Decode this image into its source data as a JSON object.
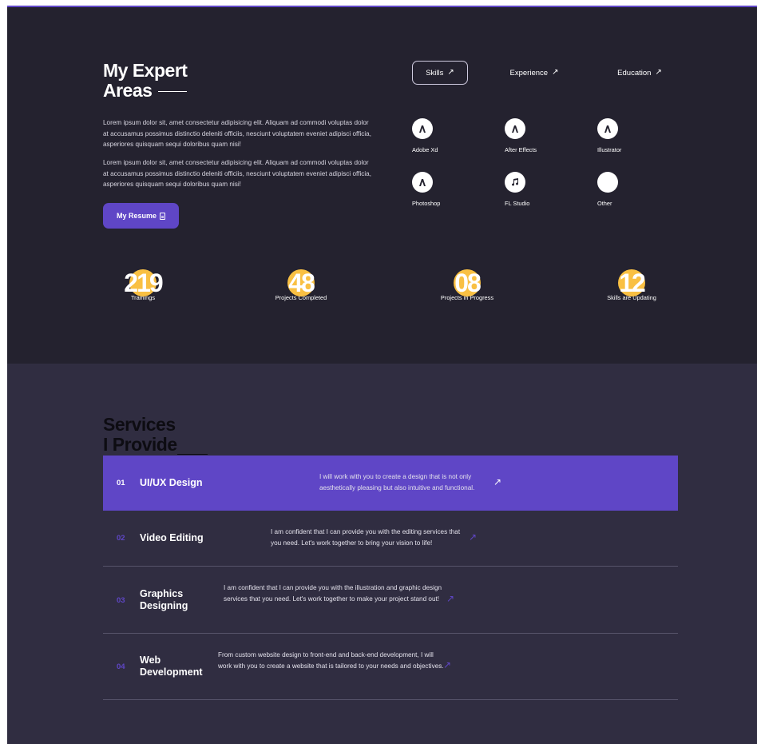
{
  "expert": {
    "title_line1": "My Expert",
    "title_line2": "Areas",
    "para1": "Lorem ipsum dolor sit, amet consectetur adipisicing elit. Aliquam ad commodi voluptas dolor at accusamus possimus distinctio deleniti officiis, nesciunt voluptatem eveniet adipisci officia, asperiores quisquam sequi doloribus quam nisi!",
    "para2": "Lorem ipsum dolor sit, amet consectetur adipisicing elit. Aliquam ad commodi voluptas dolor at accusamus possimus distinctio deleniti officiis, nesciunt voluptatem eveniet adipisci officia, asperiores quisquam sequi doloribus quam nisi!",
    "resume_label": "My Resume",
    "tabs": [
      {
        "label": "Skills",
        "active": true
      },
      {
        "label": "Experience",
        "active": false
      },
      {
        "label": "Education",
        "active": false
      }
    ],
    "skills": [
      {
        "label": "Adobe Xd",
        "icon": "adobe-icon"
      },
      {
        "label": "After Effects",
        "icon": "adobe-icon"
      },
      {
        "label": "Illustrator",
        "icon": "adobe-icon"
      },
      {
        "label": "Photoshop",
        "icon": "adobe-icon"
      },
      {
        "label": "FL Studio",
        "icon": "music-note-icon"
      },
      {
        "label": "Other",
        "icon": ""
      }
    ],
    "stats": [
      {
        "value": "219",
        "label": "Trainings"
      },
      {
        "value": "48",
        "label": "Projects Completed"
      },
      {
        "value": "08",
        "label": "Projects in Progress"
      },
      {
        "value": "12",
        "label": "Skills are Updating"
      }
    ]
  },
  "services": {
    "title_line1": "Services",
    "title_line2": "I Provide",
    "items": [
      {
        "no": "01",
        "name": "UI/UX Design",
        "desc": "I will work with you to create a design that is not only aesthetically pleasing but also intuitive and functional."
      },
      {
        "no": "02",
        "name": "Video Editing",
        "desc": "I am confident that I can provide you with the editing services that you need. Let's work together to bring your vision to life!"
      },
      {
        "no": "03",
        "name": "Graphics Designing",
        "desc": "I am confident that I can provide you with the illustration and graphic design services that you need. Let's work together to make your project stand out!"
      },
      {
        "no": "04",
        "name": "Web Development",
        "desc": "From custom website design to front-end and back-end development, I will work with you to create a website that is tailored to your needs and objectives."
      }
    ]
  },
  "colors": {
    "accent": "#5f46c6",
    "stat_dot": "#f9c043",
    "dark_bg": "#24222f",
    "services_bg": "#302d41"
  }
}
